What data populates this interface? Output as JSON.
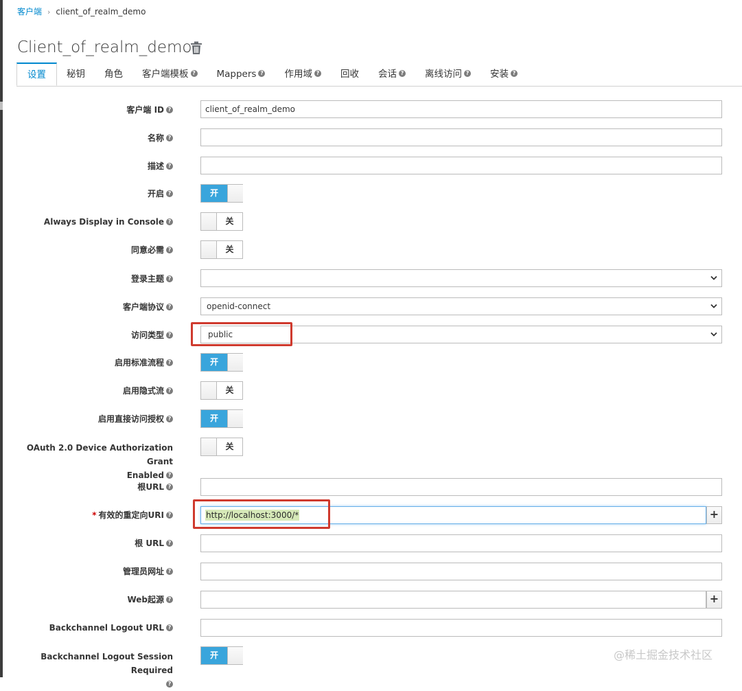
{
  "breadcrumb": {
    "root": "客户端",
    "current": "client_of_realm_demo"
  },
  "page_title": "Client_of_realm_demo",
  "tabs": [
    {
      "label": "设置",
      "help": false
    },
    {
      "label": "秘钥",
      "help": false
    },
    {
      "label": "角色",
      "help": false
    },
    {
      "label": "客户端模板",
      "help": true
    },
    {
      "label": "Mappers",
      "help": true
    },
    {
      "label": "作用域",
      "help": true
    },
    {
      "label": "回收",
      "help": false
    },
    {
      "label": "会话",
      "help": true
    },
    {
      "label": "离线访问",
      "help": true
    },
    {
      "label": "安装",
      "help": true
    }
  ],
  "form": {
    "client_id": {
      "label": "客户端 ID",
      "value": "client_of_realm_demo"
    },
    "name": {
      "label": "名称",
      "value": ""
    },
    "description": {
      "label": "描述",
      "value": ""
    },
    "enabled": {
      "label": "开启",
      "state": "开"
    },
    "always_display": {
      "label": "Always Display in Console",
      "state": "关"
    },
    "consent_required": {
      "label": "同意必需",
      "state": "关"
    },
    "login_theme": {
      "label": "登录主题",
      "value": ""
    },
    "client_protocol": {
      "label": "客户端协议",
      "value": "openid-connect"
    },
    "access_type": {
      "label": "访问类型",
      "value": "public"
    },
    "standard_flow": {
      "label": "启用标准流程",
      "state": "开"
    },
    "implicit_flow": {
      "label": "启用隐式流",
      "state": "关"
    },
    "direct_access": {
      "label": "启用直接访问授权",
      "state": "开"
    },
    "device_grant": {
      "label_line1": "OAuth 2.0 Device Authorization Grant",
      "label_line2": "Enabled",
      "state": "关"
    },
    "root_url": {
      "label": "根URL",
      "value": ""
    },
    "redirect_uri": {
      "label": "有效的重定向URI",
      "required_mark": "*",
      "value": "http://localhost:3000/*"
    },
    "base_url": {
      "label": "根 URL",
      "value": ""
    },
    "admin_url": {
      "label": "管理员网址",
      "value": ""
    },
    "web_origins": {
      "label": "Web起源",
      "value": ""
    },
    "backchannel_url": {
      "label": "Backchannel Logout URL",
      "value": ""
    },
    "backchannel_session": {
      "label": "Backchannel Logout Session Required",
      "state": "开"
    }
  },
  "add_symbol": "+",
  "help_symbol": "?",
  "watermark": "@稀土掘金技术社区",
  "colors": {
    "accent": "#0088ce",
    "toggle_on": "#39a5dc",
    "highlight": "#cf3a2e",
    "required": "#cc0000"
  }
}
